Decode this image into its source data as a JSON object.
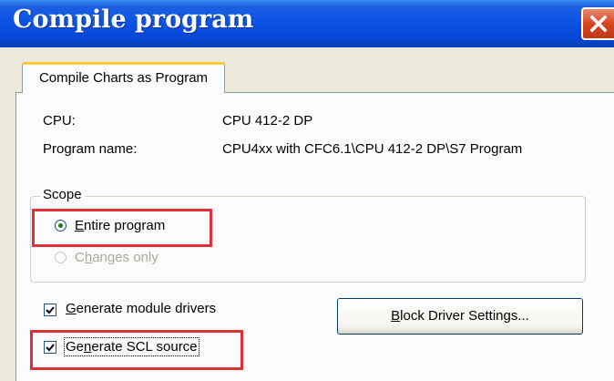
{
  "window": {
    "title": "Compile program",
    "close_icon": "close-icon",
    "accent": "#0a52e6",
    "close_color": "#d6461f"
  },
  "tab": {
    "label": "Compile Charts as Program"
  },
  "info": {
    "cpu_label": "CPU:",
    "cpu_value": "CPU 412-2 DP",
    "program_name_label": "Program name:",
    "program_name_value": "CPU4xx with CFC6.1\\CPU 412-2 DP\\S7 Program"
  },
  "scope": {
    "title": "Scope",
    "options": [
      {
        "label_mnemonic": "E",
        "label_rest": "ntire program",
        "selected": true,
        "enabled": true
      },
      {
        "label_pre": "C",
        "label_mnemonic": "h",
        "label_rest": "anges only",
        "selected": false,
        "enabled": false
      }
    ]
  },
  "options": {
    "generate_module_drivers": {
      "mnemonic": "G",
      "rest": "enerate module drivers",
      "checked": true
    },
    "generate_scl_source": {
      "pre": "Ge",
      "mnemonic": "n",
      "rest": "erate SCL source",
      "checked": true
    }
  },
  "block_driver_button": {
    "mnemonic": "B",
    "rest": "lock Driver Settings..."
  },
  "highlight_color": "#e0303a"
}
